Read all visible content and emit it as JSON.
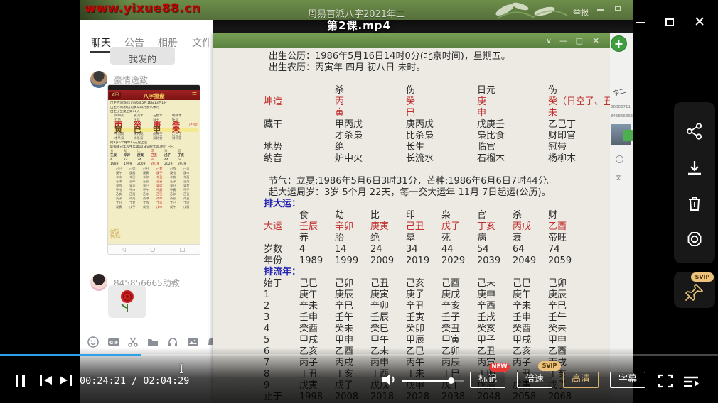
{
  "player": {
    "title": "第2课.mp4",
    "time": "00:24:21 / 02:04:29",
    "progress_percent": 19.6,
    "volume_percent": 80,
    "controls": {
      "mark": "标记",
      "mark_badge": "NEW",
      "speed": "倍速",
      "speed_badge": "SVIP",
      "quality": "高清",
      "subtitle": "字幕"
    },
    "sidebar_badge": "SVIP",
    "colors": {
      "progress_blue": "#2e9fe8",
      "new_badge": "#e53935",
      "svip_gold": "#ecc27c",
      "quality_gold": "#e6c27a"
    }
  },
  "qq": {
    "watermark": "www.yixue88.cn",
    "group_title": "周易盲派八字2021年二",
    "report_link": "举报",
    "tabs": [
      "聊天",
      "公告",
      "相册",
      "文件"
    ],
    "active_tab": "聊天",
    "filter_button": "我发的",
    "sliver_fragments": [
      "字二",
      "66086711",
      "845856665",
      "文"
    ],
    "messages": [
      {
        "sender": "豪情逸致",
        "type": "image"
      },
      {
        "sender": "845856665助教",
        "type": "emoji",
        "emoji": "rose"
      }
    ],
    "app": {
      "title": "八字排盘",
      "back": "返回",
      "menu": "☰",
      "line1": "出生时间:阳历1986年5月16日13时1分",
      "line2": "出生时间:农历丙寅年四月初八未时",
      "line3": "出生于立夏后第11天",
      "kun_label": "坤造:",
      "nayin_row": [
        "炉中火",
        "长流水",
        "石榴木",
        "杨柳木"
      ],
      "gods_row": [
        "七杀",
        "伤官",
        "日干",
        "伤官"
      ],
      "stems": [
        "丙",
        "癸",
        "庚",
        "癸"
      ],
      "stem_note": "(子丑空)",
      "branches": [
        "寅",
        "巳",
        "申",
        "未"
      ],
      "sentence1": "约3岁5个月零17天后上运",
      "sentence2": "即每逢己年和甲年第10日交脱大运,阴历 己巳",
      "nav_icons": "◁ ○ □"
    }
  },
  "doc": {
    "birth_solar": "出生公历：1986年5月16日14时0分(北京时间)，星期五。",
    "birth_lunar": "出生农历：丙寅年 四月 初八日 未时。",
    "pillars": {
      "gods": [
        "杀",
        "伤",
        "日元",
        "伤"
      ],
      "label": "坤造",
      "stems": [
        "丙",
        "癸",
        "庚",
        "癸（日空子、丑）"
      ],
      "branches": [
        "寅",
        "巳",
        "申",
        "未"
      ],
      "canggan_label": "藏干",
      "canggan": [
        "甲丙戊",
        "庚丙戊",
        "戊庚壬",
        "乙己丁"
      ],
      "canggan_gods": [
        "才杀枭",
        "比杀枭",
        "枭比食",
        "财印官"
      ],
      "dishi_label": "地势",
      "dishi": [
        "绝",
        "长生",
        "临官",
        "冠带"
      ],
      "nayin_label": "纳音",
      "nayin": [
        "炉中火",
        "长流水",
        "石榴木",
        "杨柳木"
      ]
    },
    "jieqi": "节气：立夏:1986年5月6日3时31分，芒种:1986年6月6日7时44分。",
    "qiyun": "起大运周岁：3岁 5个月 22天，每一交大运年 11月 7日起运(公历)。",
    "dayun_heading": "排大运：",
    "dayun": {
      "gods": [
        "食",
        "劫",
        "比",
        "印",
        "枭",
        "官",
        "杀",
        "财"
      ],
      "label": "大运",
      "pillars": [
        "壬辰",
        "辛卯",
        "庚寅",
        "己丑",
        "戊子",
        "丁亥",
        "丙戌",
        "乙酉"
      ],
      "stages": [
        "养",
        "胎",
        "绝",
        "墓",
        "死",
        "病",
        "衰",
        "帝旺"
      ],
      "age_label": "岁数",
      "ages": [
        "4",
        "14",
        "24",
        "34",
        "44",
        "54",
        "64",
        "74"
      ],
      "year_label": "年份",
      "years": [
        "1989",
        "1999",
        "2009",
        "2019",
        "2029",
        "2039",
        "2049",
        "2059"
      ]
    },
    "liunian_heading": "排流年：",
    "liunian": {
      "rows": [
        {
          "label": "始于",
          "cells": [
            "己巳",
            "己卯",
            "己丑",
            "己亥",
            "己酉",
            "己未",
            "己巳",
            "己卯"
          ]
        },
        {
          "label": "1",
          "cells": [
            "庚午",
            "庚辰",
            "庚寅",
            "庚子",
            "庚戌",
            "庚申",
            "庚午",
            "庚辰"
          ]
        },
        {
          "label": "2",
          "cells": [
            "辛未",
            "辛巳",
            "辛卯",
            "辛丑",
            "辛亥",
            "辛酉",
            "辛未",
            "辛巳"
          ]
        },
        {
          "label": "3",
          "cells": [
            "壬申",
            "壬午",
            "壬辰",
            "壬寅",
            "壬子",
            "壬戌",
            "壬申",
            "壬午"
          ]
        },
        {
          "label": "4",
          "cells": [
            "癸酉",
            "癸未",
            "癸巳",
            "癸卯",
            "癸丑",
            "癸亥",
            "癸酉",
            "癸未"
          ]
        },
        {
          "label": "5",
          "cells": [
            "甲戌",
            "甲申",
            "甲午",
            "甲辰",
            "甲寅",
            "甲子",
            "甲戌",
            "甲申"
          ]
        },
        {
          "label": "6",
          "cells": [
            "乙亥",
            "乙酉",
            "乙未",
            "乙巳",
            "乙卯",
            "乙丑",
            "乙亥",
            "乙酉"
          ]
        },
        {
          "label": "7",
          "cells": [
            "丙子",
            "丙戌",
            "丙申",
            "丙午",
            "丙辰",
            "丙寅",
            "丙子",
            "丙戌"
          ]
        },
        {
          "label": "8",
          "cells": [
            "丁丑",
            "丁亥",
            "丁酉",
            "丁未",
            "丁巳",
            "丁卯",
            "丁丑",
            "丁亥"
          ]
        },
        {
          "label": "9",
          "cells": [
            "戊寅",
            "戊子",
            "戊戌",
            "戊申",
            "戊午",
            "戊辰",
            "戊寅",
            "戊子"
          ]
        },
        {
          "label": "止于",
          "cells": [
            "1998",
            "2008",
            "2018",
            "2028",
            "2038",
            "2048",
            "2058",
            "2068"
          ]
        }
      ]
    }
  }
}
